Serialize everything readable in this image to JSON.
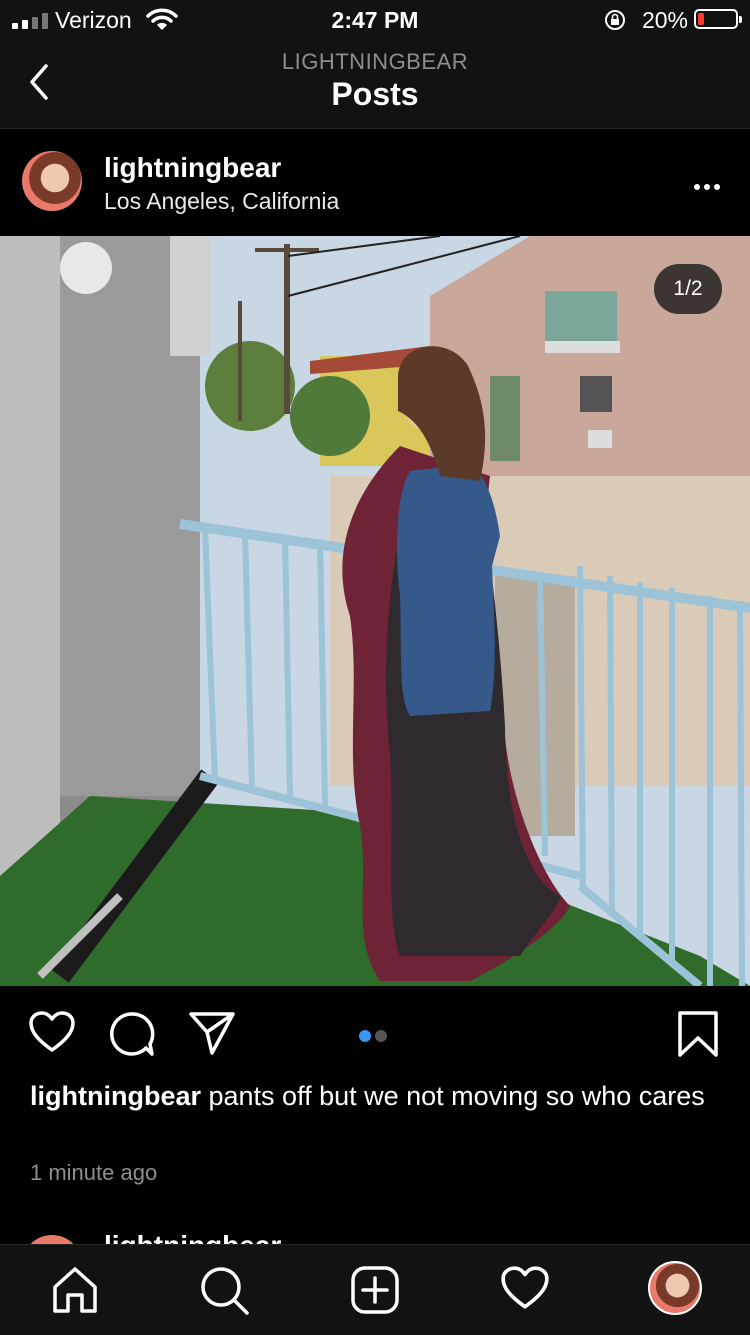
{
  "status_bar": {
    "carrier": "Verizon",
    "time": "2:47 PM",
    "battery": "20%",
    "battery_level": 0.2,
    "battery_color": "#ff3b30"
  },
  "nav": {
    "subtitle": "LIGHTNINGBEAR",
    "title": "Posts"
  },
  "post": {
    "username": "lightningbear",
    "location": "Los Angeles, California",
    "counter": "1/2",
    "photo_icon": "post-photo",
    "carousel": {
      "count": 2,
      "active": 0,
      "active_color": "#3897f0"
    },
    "caption_user": "lightningbear",
    "caption_text": " pants off but we not moving so who cares",
    "time_ago": "1 minute ago"
  },
  "next_post": {
    "username": "lightningbear"
  },
  "icons": {
    "back": "chevron-left-icon",
    "more": "more-icon",
    "like": "heart-icon",
    "comment": "comment-icon",
    "share": "send-icon",
    "save": "bookmark-icon",
    "home": "home-icon",
    "search": "search-icon",
    "add": "add-icon",
    "activity": "heart-icon"
  }
}
